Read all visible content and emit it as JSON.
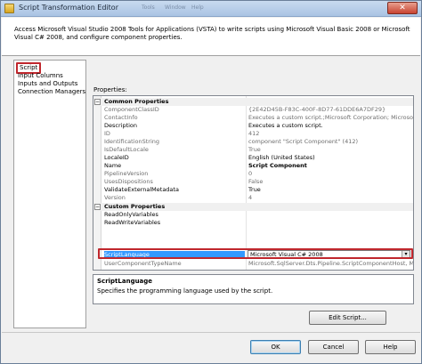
{
  "window": {
    "title": "Script Transformation Editor",
    "ghost_menu": [
      "Tools",
      "Window",
      "Help"
    ],
    "close_label": "✕"
  },
  "header": {
    "description": "Access Microsoft Visual Studio 2008 Tools for Applications (VSTA) to write scripts using Microsoft Visual Basic 2008 or Microsoft Visual C# 2008, and configure component properties."
  },
  "nav": {
    "items": [
      "Script",
      "Input Columns",
      "Inputs and Outputs",
      "Connection Managers"
    ]
  },
  "properties": {
    "label": "Properties:",
    "categories": [
      {
        "name": "Common Properties",
        "toggle": "−",
        "rows": [
          {
            "name": "ComponentClassID",
            "value": "{2E42D45B-F83C-400F-8D77-61DDE6A7DF29}",
            "readonly": true
          },
          {
            "name": "ContactInfo",
            "value": "Executes a custom script.;Microsoft Corporation; Microsoft S",
            "readonly": true
          },
          {
            "name": "Description",
            "value": "Executes a custom script.",
            "readonly": false
          },
          {
            "name": "ID",
            "value": "412",
            "readonly": true
          },
          {
            "name": "IdentificationString",
            "value": "component \"Script Component\" (412)",
            "readonly": true
          },
          {
            "name": "IsDefaultLocale",
            "value": "True",
            "readonly": true
          },
          {
            "name": "LocaleID",
            "value": "English (United States)",
            "readonly": false
          },
          {
            "name": "Name",
            "value": "Script Component",
            "readonly": false,
            "bold": true
          },
          {
            "name": "PipelineVersion",
            "value": "0",
            "readonly": true
          },
          {
            "name": "UsesDispositions",
            "value": "False",
            "readonly": true
          },
          {
            "name": "ValidateExternalMetadata",
            "value": "True",
            "readonly": false
          },
          {
            "name": "Version",
            "value": "4",
            "readonly": true
          }
        ]
      },
      {
        "name": "Custom Properties",
        "toggle": "−",
        "rows": [
          {
            "name": "ReadOnlyVariables",
            "value": "",
            "readonly": false
          },
          {
            "name": "ReadWriteVariables",
            "value": "",
            "readonly": false
          },
          {
            "name": "ScriptLanguage",
            "value": "Microsoft Visual C# 2008",
            "readonly": false,
            "selected": true
          },
          {
            "name": "UserComponentTypeName",
            "value": "Microsoft.SqlServer.Dts.Pipeline.ScriptComponentHost, Micr",
            "readonly": true
          }
        ]
      }
    ],
    "dropdown_arrow": "▾"
  },
  "help": {
    "title": "ScriptLanguage",
    "text": "Specifies the programming language used by the script."
  },
  "buttons": {
    "edit_script": "Edit Script...",
    "ok": "OK",
    "cancel": "Cancel",
    "help": "Help"
  }
}
